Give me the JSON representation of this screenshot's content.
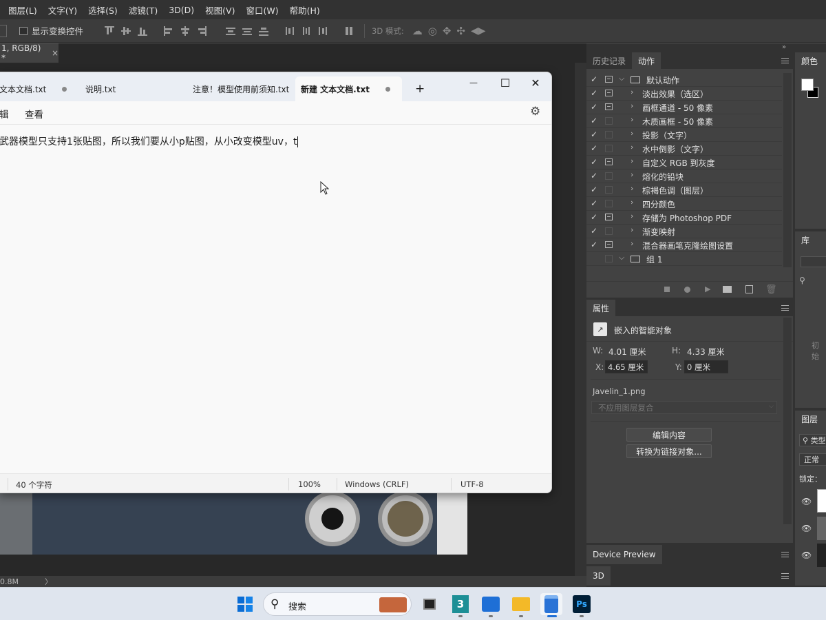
{
  "ps": {
    "menu": [
      "图层(L)",
      "文字(Y)",
      "选择(S)",
      "滤镜(T)",
      "3D(D)",
      "视图(V)",
      "窗口(W)",
      "帮助(H)"
    ],
    "options": {
      "show_transform": "显示变换控件",
      "mode_3d": "3D 模式:"
    },
    "doc_tab": "1, RGB/8) *",
    "doc_tab_close": "×",
    "status_left": "0.8M",
    "status_arrow": "〉"
  },
  "notepad": {
    "tabs": [
      "文本文档.txt",
      "说明.txt",
      "注意！模型使用前须知.txt",
      "新建 文本文档.txt"
    ],
    "new_tab": "+",
    "window_buttons": {
      "minimize": "—",
      "maximize": "☐",
      "close": "✕"
    },
    "menu": [
      "辑",
      "查看"
    ],
    "content": "武器模型只支持1张贴图，所以我们要从小p贴图，从小改变模型uv，t",
    "status": {
      "chars": "40 个字符",
      "zoom": "100%",
      "line_ending": "Windows (CRLF)",
      "encoding": "UTF-8"
    }
  },
  "actions_panel": {
    "tabs": [
      "历史记录",
      "动作"
    ],
    "rows": [
      {
        "check": "✓",
        "dialog": true,
        "label": "默认动作",
        "folder": true,
        "open": true
      },
      {
        "check": "✓",
        "dialog": true,
        "label": "淡出效果（选区）"
      },
      {
        "check": "✓",
        "dialog": true,
        "label": "画框通道 - 50 像素"
      },
      {
        "check": "✓",
        "dialog": false,
        "label": "木质画框 - 50 像素"
      },
      {
        "check": "✓",
        "dialog": false,
        "label": "投影（文字）"
      },
      {
        "check": "✓",
        "dialog": false,
        "label": "水中倒影（文字）"
      },
      {
        "check": "✓",
        "dialog": true,
        "label": "自定义 RGB 到灰度"
      },
      {
        "check": "✓",
        "dialog": false,
        "label": "熔化的铅块"
      },
      {
        "check": "✓",
        "dialog": false,
        "label": "棕褐色调（图层）"
      },
      {
        "check": "✓",
        "dialog": false,
        "label": "四分颜色"
      },
      {
        "check": "✓",
        "dialog": true,
        "label": "存储为 Photoshop PDF"
      },
      {
        "check": "✓",
        "dialog": false,
        "label": "渐变映射"
      },
      {
        "check": "✓",
        "dialog": true,
        "label": "混合器画笔克隆绘图设置"
      },
      {
        "check": "",
        "dialog": false,
        "label": "组 1",
        "folder": true,
        "open": true
      }
    ]
  },
  "properties_panel": {
    "tab": "属性",
    "type": "嵌入的智能对象",
    "w_label": "W:",
    "w": "4.01 厘米",
    "h_label": "H:",
    "h": "4.33 厘米",
    "x_label": "X:",
    "x": "4.65 厘米",
    "y_label": "Y:",
    "y": "0 厘米",
    "file": "Javelin_1.png",
    "comp": "不应用图层复合",
    "btn_edit": "编辑内容",
    "btn_convert": "转换为链接对象..."
  },
  "device_preview": "Device Preview",
  "panel_3d": "3D",
  "far_right": {
    "color_tab": "颜色",
    "library_tab": "库",
    "library_init": "初始",
    "layers_tab": "图层",
    "layers_kind": "类型",
    "blend": "正常",
    "lock": "锁定："
  },
  "taskbar": {
    "search": "搜索"
  },
  "colors": {
    "ps_bg": "#535353",
    "ps_dark": "#282828",
    "notepad_bg": "#f9f9f9",
    "taskbar": "#dfe5ee"
  }
}
